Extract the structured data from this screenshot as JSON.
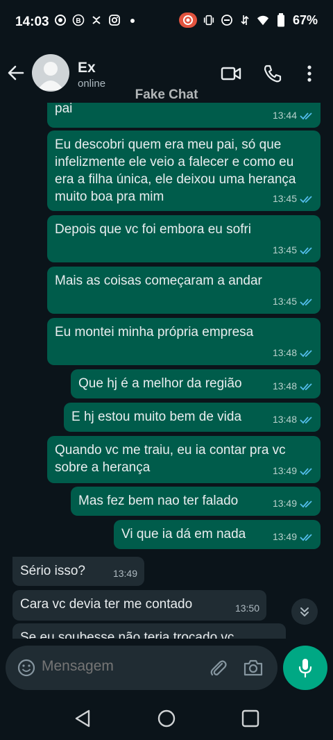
{
  "status_bar": {
    "time": "14:03",
    "battery": "67%"
  },
  "header": {
    "contact_name": "Ex",
    "contact_status": "online",
    "watermark": "Fake Chat"
  },
  "messages": [
    {
      "dir": "out",
      "text": "pai",
      "time": "13:44"
    },
    {
      "dir": "out",
      "text": "Eu descobri quem era meu pai, só que infelizmente ele veio a falecer e como eu era a filha única, ele deixou uma herança muito boa pra mim",
      "time": "13:45"
    },
    {
      "dir": "out",
      "text": "Depois que vc foi embora eu sofri",
      "time": "13:45"
    },
    {
      "dir": "out",
      "text": "Mais as coisas começaram a andar",
      "time": "13:45"
    },
    {
      "dir": "out",
      "text": "Eu montei minha própria empresa",
      "time": "13:48"
    },
    {
      "dir": "out",
      "text": "Que hj é a melhor da região",
      "time": "13:48"
    },
    {
      "dir": "out",
      "text": "E hj estou muito bem de vida",
      "time": "13:48"
    },
    {
      "dir": "out",
      "text": "Quando vc me traiu, eu ia contar pra vc sobre a herança",
      "time": "13:49"
    },
    {
      "dir": "out",
      "text": "Mas fez bem nao ter falado",
      "time": "13:49"
    },
    {
      "dir": "out",
      "text": "Vi que ia dá em nada",
      "time": "13:49"
    },
    {
      "dir": "in",
      "text": "Sério isso?",
      "time": "13:49"
    },
    {
      "dir": "in",
      "text": "Cara vc devia ter me contado",
      "time": "13:50"
    },
    {
      "dir": "in",
      "text": "Se eu soubesse não teria trocado vc",
      "time": ""
    }
  ],
  "input": {
    "placeholder": "Mensagem"
  },
  "colors": {
    "background": "#0b141a",
    "outgoing_bubble": "#005c4b",
    "incoming_bubble": "#202c33",
    "read_ticks": "#53bdeb",
    "accent": "#00a884"
  }
}
